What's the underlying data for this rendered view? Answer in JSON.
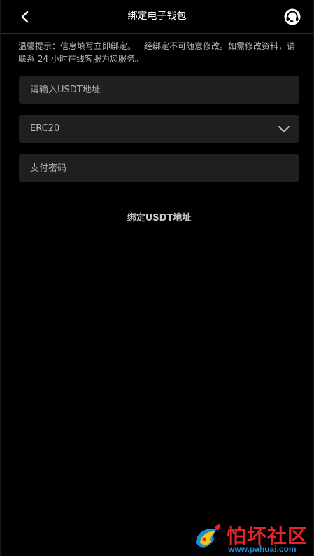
{
  "header": {
    "title": "绑定电子钱包",
    "back_icon": "chevron-left-icon",
    "service_icon": "customer-service-icon"
  },
  "notice": {
    "text": "温馨提示：信息填写立即绑定。一经绑定不可随意修改。如需修改资料，请联系 24 小时在线客服为您服务。"
  },
  "form": {
    "address_placeholder": "请输入USDT地址",
    "address_value": "",
    "network_selected": "ERC20",
    "password_placeholder": "支付密码",
    "password_value": "",
    "submit_label": "绑定USDT地址"
  },
  "watermark": {
    "title": "怕坏社区",
    "url": "www.pahuai.com"
  },
  "colors": {
    "background": "#000000",
    "field_bg": "#1f1f1f",
    "watermark_red": "#e0262a",
    "watermark_blue": "#1e8fd6"
  }
}
